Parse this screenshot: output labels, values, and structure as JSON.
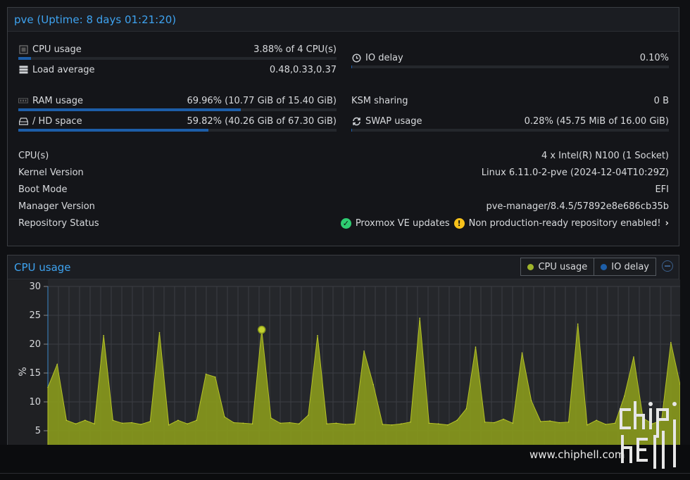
{
  "status": {
    "title": "pve (Uptime: 8 days 01:21:20)",
    "cpu_usage": {
      "label": "CPU usage",
      "value": "3.88% of 4 CPU(s)",
      "percent": 3.88
    },
    "load_average": {
      "label": "Load average",
      "value": "0.48,0.33,0.37"
    },
    "io_delay": {
      "label": "IO delay",
      "value": "0.10%",
      "percent": 0.1
    },
    "ram_usage": {
      "label": "RAM usage",
      "value": "69.96% (10.77 GiB of 15.40 GiB)",
      "percent": 69.96
    },
    "ksm_sharing": {
      "label": "KSM sharing",
      "value": "0 B"
    },
    "hd_space": {
      "label": "/ HD space",
      "value": "59.82% (40.26 GiB of 67.30 GiB)",
      "percent": 59.82
    },
    "swap_usage": {
      "label": "SWAP usage",
      "value": "0.28% (45.75 MiB of 16.00 GiB)",
      "percent": 0.28
    },
    "info": {
      "cpus": {
        "label": "CPU(s)",
        "value": "4 x Intel(R) N100 (1 Socket)"
      },
      "kernel": {
        "label": "Kernel Version",
        "value": "Linux 6.11.0-2-pve (2024-12-04T10:29Z)"
      },
      "boot": {
        "label": "Boot Mode",
        "value": "EFI"
      },
      "manager": {
        "label": "Manager Version",
        "value": "pve-manager/8.4.5/57892e8e686cb35b"
      },
      "repo": {
        "label": "Repository Status",
        "ok_text": "Proxmox VE updates",
        "warn_text": "Non production-ready repository enabled!"
      }
    }
  },
  "cpu_panel": {
    "title": "CPU usage",
    "legend": [
      {
        "label": "CPU usage",
        "color": "#9fb42b"
      },
      {
        "label": "IO delay",
        "color": "#1d5ea8"
      }
    ]
  },
  "chart_data": {
    "type": "area",
    "ylabel": "%",
    "ylim": [
      0,
      30
    ],
    "yticks": [
      "30",
      "25",
      "20",
      "15",
      "10",
      "5"
    ],
    "grid": true,
    "series": [
      {
        "name": "CPU usage",
        "color": "#b5c226",
        "values": [
          12.5,
          16.5,
          6.8,
          6.2,
          6.8,
          6.2,
          21.5,
          6.8,
          6.3,
          6.4,
          6.1,
          6.6,
          22.0,
          6.0,
          6.8,
          6.2,
          6.8,
          14.8,
          14.3,
          7.4,
          6.4,
          6.3,
          6.2,
          22.5,
          7.2,
          6.3,
          6.4,
          6.2,
          7.7,
          21.5,
          6.2,
          6.3,
          6.1,
          6.2,
          18.8,
          13.0,
          6.1,
          6.0,
          6.2,
          6.5,
          24.5,
          6.3,
          6.2,
          6.0,
          6.8,
          8.8,
          19.5,
          6.5,
          6.4,
          7.0,
          6.3,
          18.5,
          10.2,
          6.6,
          6.7,
          6.4,
          6.5,
          23.5,
          6.0,
          6.8,
          6.1,
          6.3,
          11.0,
          17.8,
          7.2,
          6.2,
          6.8,
          20.3,
          13.0
        ],
        "highlight_index": 23
      },
      {
        "name": "IO delay",
        "color": "#1d5ea8",
        "values": []
      }
    ]
  },
  "footer": {
    "watermark_url": "www.chiphell.com"
  }
}
